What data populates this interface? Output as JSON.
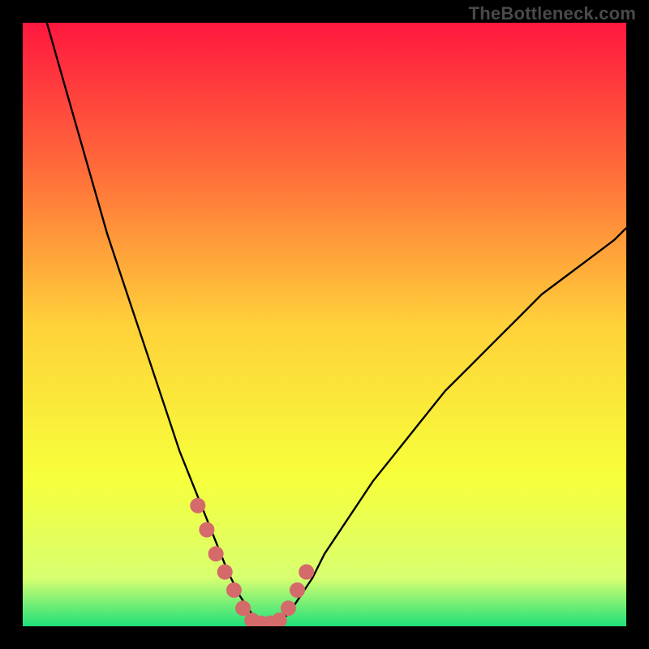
{
  "attribution": "TheBottleneck.com",
  "gradient": {
    "c0": "#ff173f",
    "c1": "#ff6f3a",
    "c2": "#ffd13a",
    "c3": "#f7ff3a",
    "c4": "#d8ff70",
    "c5": "#1fe07a"
  },
  "marker_color": "#d46a6a",
  "chart_data": {
    "type": "line",
    "title": "",
    "xlabel": "",
    "ylabel": "",
    "xlim": [
      0,
      100
    ],
    "ylim": [
      0,
      100
    ],
    "series": [
      {
        "name": "curve",
        "x": [
          4,
          6,
          8,
          10,
          12,
          14,
          16,
          18,
          20,
          22,
          24,
          26,
          28,
          30,
          32,
          34,
          35,
          36,
          37,
          38,
          39,
          40,
          42,
          44,
          46,
          48,
          50,
          54,
          58,
          62,
          66,
          70,
          74,
          78,
          82,
          86,
          90,
          94,
          98,
          100
        ],
        "y": [
          100,
          93,
          86,
          79,
          72,
          65,
          59,
          53,
          47,
          41,
          35,
          29,
          24,
          19,
          14,
          9,
          7,
          5,
          3.5,
          2,
          1,
          0.5,
          0.5,
          2,
          5,
          8,
          12,
          18,
          24,
          29,
          34,
          39,
          43,
          47,
          51,
          55,
          58,
          61,
          64,
          66
        ]
      }
    ],
    "markers": {
      "name": "emphasis-dots",
      "x": [
        29,
        30.5,
        32,
        33.5,
        35,
        36.5,
        38,
        39.5,
        41,
        42.5,
        44,
        45.5,
        47
      ],
      "y": [
        20,
        16,
        12,
        9,
        6,
        3,
        1,
        0.5,
        0.5,
        1,
        3,
        6,
        9
      ]
    }
  }
}
